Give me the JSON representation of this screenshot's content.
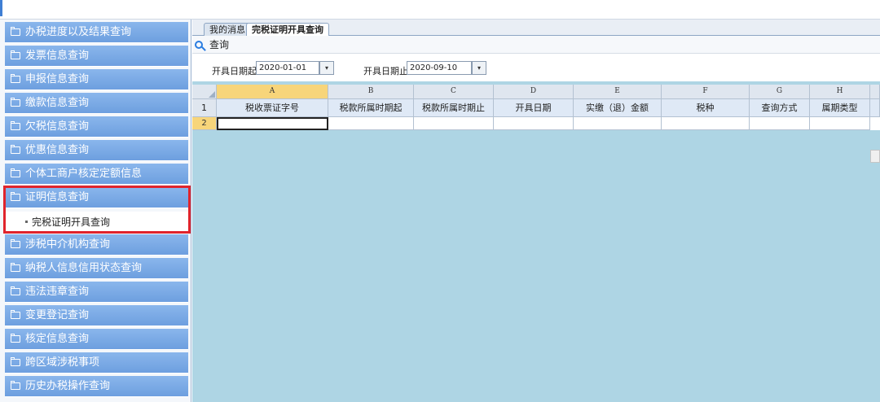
{
  "sidebar": {
    "items": [
      {
        "label": "办税进度以及结果查询"
      },
      {
        "label": "发票信息查询"
      },
      {
        "label": "申报信息查询"
      },
      {
        "label": "缴款信息查询"
      },
      {
        "label": "欠税信息查询"
      },
      {
        "label": "优惠信息查询"
      },
      {
        "label": "个体工商户核定定额信息"
      },
      {
        "label": "证明信息查询",
        "expanded": true
      },
      {
        "label": "涉税中介机构查询"
      },
      {
        "label": "纳税人信息信用状态查询"
      },
      {
        "label": "违法违章查询"
      },
      {
        "label": "变更登记查询"
      },
      {
        "label": "核定信息查询"
      },
      {
        "label": "跨区域涉税事项"
      },
      {
        "label": "历史办税操作查询"
      }
    ],
    "subitem": {
      "label": "完税证明开具查询"
    },
    "highlight_color": "#e0242c",
    "menu_color": "#6d9fdf"
  },
  "tabs": [
    {
      "label": "我的消息"
    },
    {
      "label": "完税证明开具查询",
      "active": true
    }
  ],
  "toolbar": {
    "query_label": "查询",
    "icon": "search-icon"
  },
  "filters": {
    "start_label": "开具日期起",
    "start_value": "2020-01-01",
    "end_label": "开具日期止",
    "end_value": "2020-09-10",
    "calendar_glyph": "▾"
  },
  "grid": {
    "column_letters": [
      "A",
      "B",
      "C",
      "D",
      "E",
      "F",
      "G",
      "H"
    ],
    "headers": [
      "税收票证字号",
      "税款所属时期起",
      "税款所属时期止",
      "开具日期",
      "实缴（退）金额",
      "税种",
      "查询方式",
      "属期类型"
    ],
    "row_numbers": [
      "1",
      "2"
    ],
    "background": "#aed5e4"
  }
}
